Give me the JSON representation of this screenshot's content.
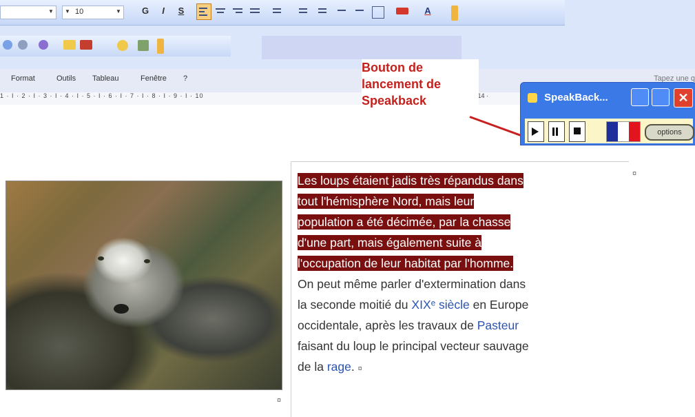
{
  "toolbar": {
    "font_size": "10",
    "bold": "G",
    "italic": "I",
    "underline": "S",
    "font_color_letter": "A"
  },
  "menu": {
    "items": [
      "Format",
      "Outils",
      "Tableau",
      "Fenêtre",
      "?"
    ],
    "help_placeholder": "Tapez une q"
  },
  "ruler": {
    "text": "1 · I · 2 · I · 3 · I · 4 · I · 5 · I · 6 · I · 7 · I · 8 · I · 9 · I · 10",
    "text_tail": "· I ·14 ·"
  },
  "callout": {
    "line1": "Bouton de",
    "line2": "lancement de",
    "line3": "Speakback"
  },
  "speakback": {
    "title": "SpeakBack...",
    "close_glyph": "✕",
    "options_label": "options",
    "flag_colors": [
      "#1d2f9b",
      "#ffffff",
      "#e2151f"
    ]
  },
  "document": {
    "highlighted": [
      "Les loups étaient jadis très répandus dans",
      "tout l'hémisphère Nord, mais leur",
      "population a été décimée, par la chasse",
      "d'une part, mais également suite à",
      "l'occupation de leur habitat par l'homme."
    ],
    "body": [
      "On peut même parler d'extermination dans",
      "la seconde moitié du",
      "en Europe",
      "occidentale, après les travaux de",
      "faisant du loup le principal vecteur sauvage",
      "de la"
    ],
    "link_century": "XIXᵉ siècle",
    "link_pasteur": "Pasteur",
    "link_rage": "rage",
    "end_marks": [
      "¤",
      "¤",
      "¤"
    ]
  },
  "colors": {
    "highlight_bg": "#7a0f0f",
    "link": "#2b53b5",
    "callout_text": "#c4211d"
  }
}
